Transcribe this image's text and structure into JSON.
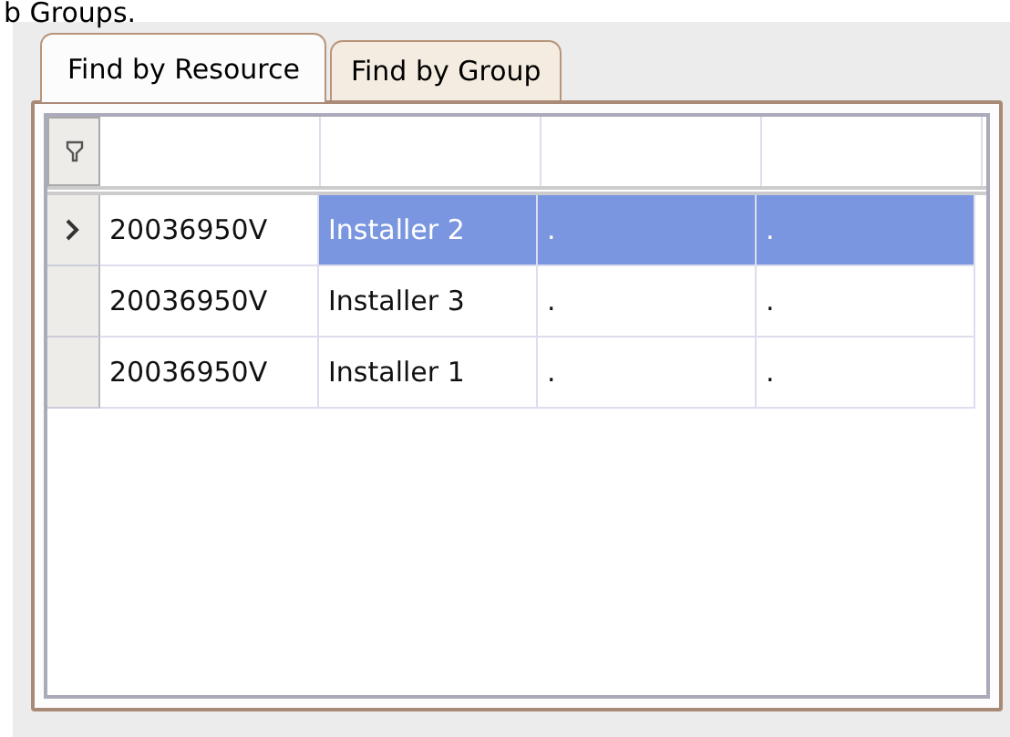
{
  "caption": "b Groups.",
  "tabs": [
    {
      "label": "Find by Resource",
      "selected": true
    },
    {
      "label": "Find by Group",
      "selected": false
    }
  ],
  "table": {
    "rows": [
      {
        "selected": true,
        "cells": [
          "20036950V",
          "Installer 2",
          ".",
          "."
        ]
      },
      {
        "selected": false,
        "cells": [
          "20036950V",
          "Installer 3",
          ".",
          "."
        ]
      },
      {
        "selected": false,
        "cells": [
          "20036950V",
          "Installer 1",
          ".",
          "."
        ]
      }
    ]
  }
}
